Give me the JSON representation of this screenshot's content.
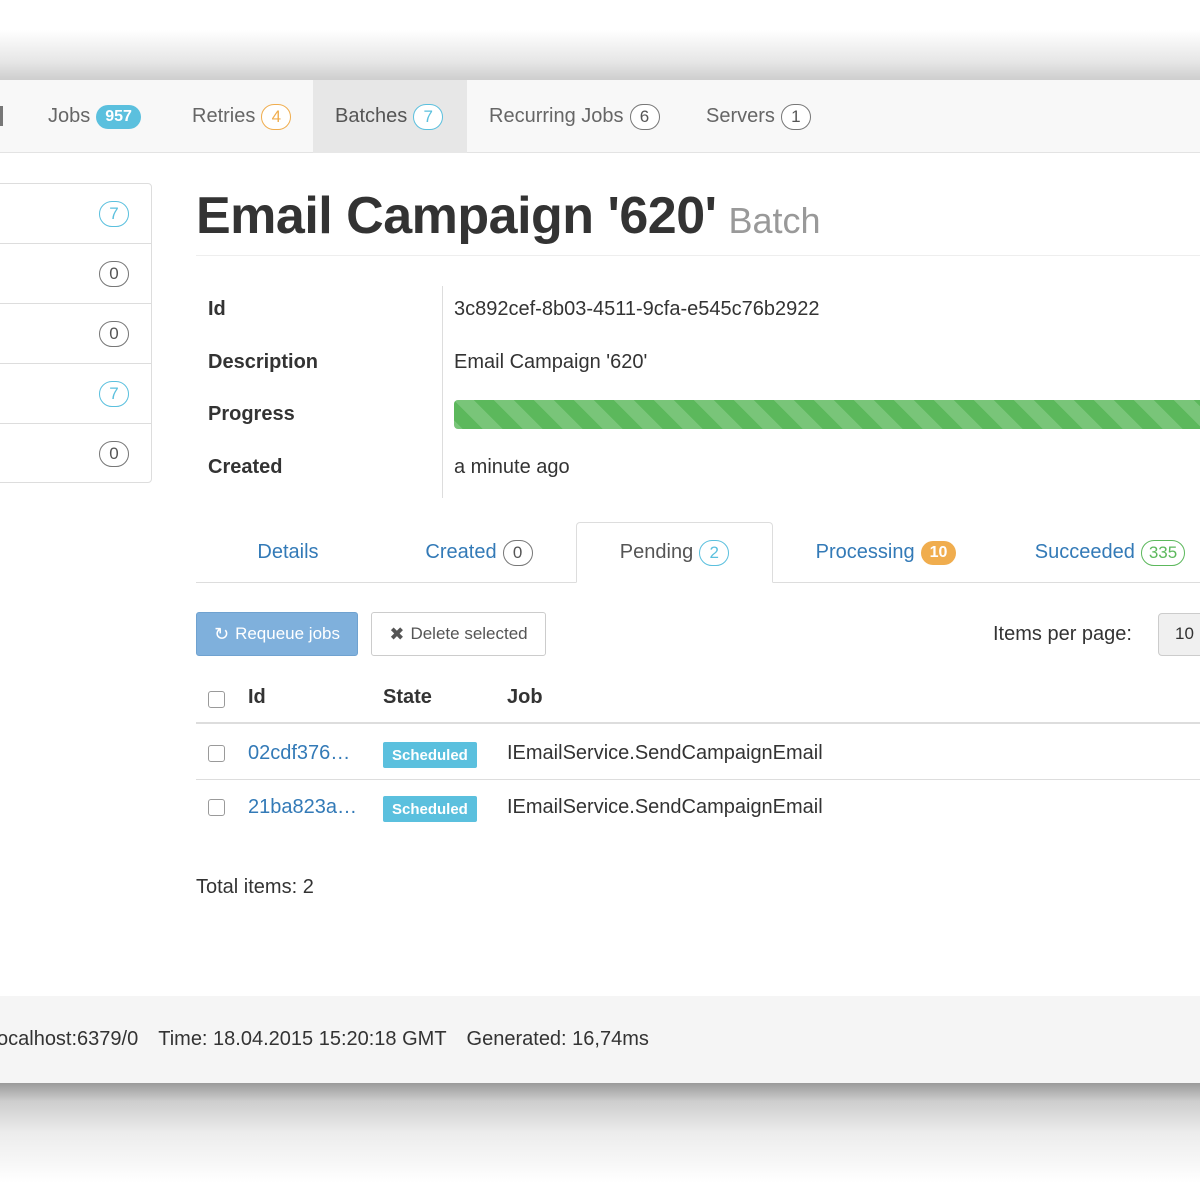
{
  "nav": {
    "items": [
      {
        "label": "Jobs",
        "badge": "957"
      },
      {
        "label": "Retries",
        "badge": "4"
      },
      {
        "label": "Batches",
        "badge": "7"
      },
      {
        "label": "Recurring Jobs",
        "badge": "6"
      },
      {
        "label": "Servers",
        "badge": "1"
      }
    ],
    "active": "Batches"
  },
  "sidebar": {
    "counts": [
      "7",
      "0",
      "0",
      "7",
      "0"
    ]
  },
  "page": {
    "title": "Email Campaign '620'",
    "subtitle": "Batch"
  },
  "details": {
    "id_label": "Id",
    "id_value": "3c892cef-8b03-4511-9cfa-e545c76b2922",
    "description_label": "Description",
    "description_value": "Email Campaign '620'",
    "progress_label": "Progress",
    "created_label": "Created",
    "created_value": "a minute ago"
  },
  "tabs": [
    {
      "label": "Details",
      "badge": ""
    },
    {
      "label": "Created",
      "badge": "0"
    },
    {
      "label": "Pending",
      "badge": "2"
    },
    {
      "label": "Processing",
      "badge": "10"
    },
    {
      "label": "Succeeded",
      "badge": "335"
    }
  ],
  "active_tab": "Pending",
  "toolbar": {
    "requeue_label": "Requeue jobs",
    "delete_label": "Delete selected",
    "items_per_page_label": "Items per page:",
    "items_per_page_value": "10"
  },
  "table": {
    "columns": [
      "Id",
      "State",
      "Job"
    ],
    "rows": [
      {
        "id": "02cdf376…",
        "state": "Scheduled",
        "job": "IEmailService.SendCampaignEmail"
      },
      {
        "id": "21ba823a…",
        "state": "Scheduled",
        "job": "IEmailService.SendCampaignEmail"
      }
    ]
  },
  "total_items": "Total items: 2",
  "footer": {
    "connection": "ocalhost:6379/0",
    "time": "Time: 18.04.2015 15:20:18 GMT",
    "generated": "Generated: 16,74ms"
  },
  "colors": {
    "link": "#337ab7",
    "info": "#5bc0de",
    "warning": "#f0ad4e",
    "success": "#5cb85c"
  }
}
